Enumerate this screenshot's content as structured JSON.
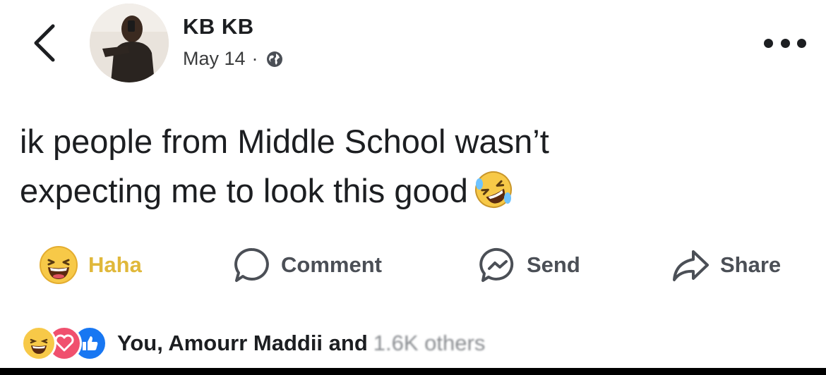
{
  "post": {
    "author_name": "KB KB",
    "date": "May 14",
    "separator": "·",
    "privacy_icon": "globe-icon",
    "text_line1": "ik people from Middle School wasn’t",
    "text_line2": "expecting me to look this good",
    "inline_emoji": "rolling-on-floor-laughing-emoji"
  },
  "actions": {
    "haha_label": "Haha",
    "comment_label": "Comment",
    "send_label": "Send",
    "share_label": "Share"
  },
  "reactions": {
    "summary_text": "You, Amourr Maddii and",
    "obscured_text": "1.6K others",
    "icons": [
      "haha-reaction-icon",
      "love-reaction-icon",
      "like-reaction-icon"
    ]
  },
  "colors": {
    "haha_yellow": "#f7c948",
    "love_red": "#f0506e",
    "like_blue": "#1877f2",
    "text_dark": "#1c1e21"
  }
}
